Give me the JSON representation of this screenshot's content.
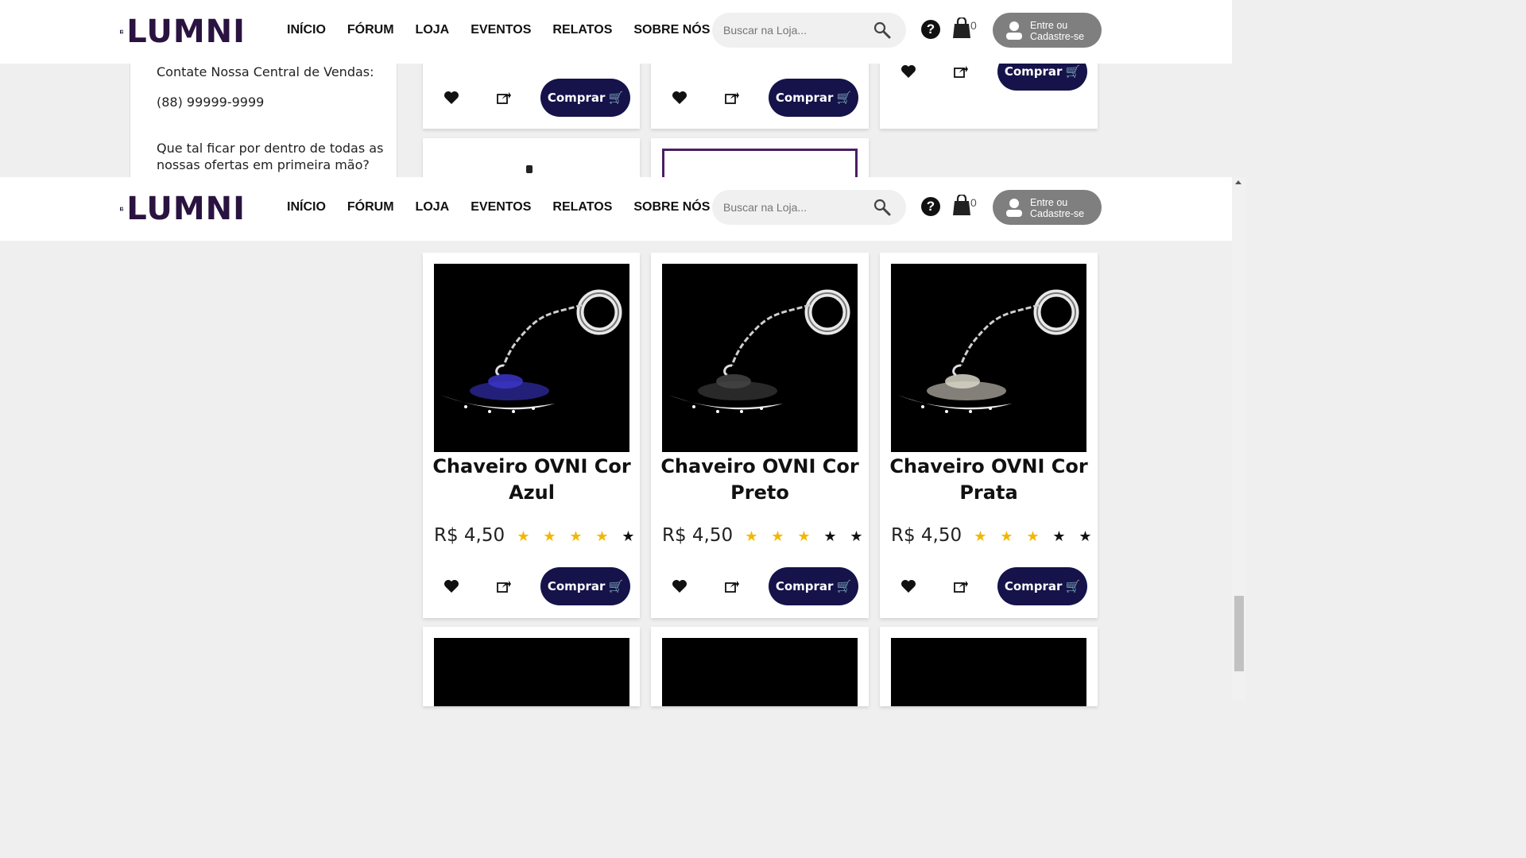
{
  "brand": {
    "name": "LUMNI"
  },
  "nav": {
    "items": [
      "INÍCIO",
      "FÓRUM",
      "LOJA",
      "EVENTOS",
      "RELATOS",
      "SOBRE NÓS"
    ]
  },
  "search": {
    "placeholder": "Buscar na Loja..."
  },
  "help_icon_glyph": "?",
  "cart": {
    "count": "0"
  },
  "login": {
    "line1": "Entre ou",
    "line2": "Cadastre-se"
  },
  "sidebar": {
    "contact_text": "Contate Nossa Central de Vendas:",
    "phone": "(88) 99999-9999",
    "newsletter_text": "Que tal ficar por dentro de todas as nossas ofertas em primeira mão?"
  },
  "buy_label": "Comprar",
  "products": [
    {
      "title_line1": "Chaveiro OVNI Cor",
      "title_line2": "Azul",
      "price": "R$ 4,50",
      "rating": 4,
      "accent": "#3b35c9"
    },
    {
      "title_line1": "Chaveiro OVNI Cor",
      "title_line2": "Preto",
      "price": "R$ 4,50",
      "rating": 3,
      "accent": "#444444"
    },
    {
      "title_line1": "Chaveiro OVNI Cor",
      "title_line2": "Prata",
      "price": "R$ 4,50",
      "rating": 3,
      "accent": "#d9d6c8"
    }
  ],
  "colors": {
    "buy_button": "#15134a",
    "star_on": "#f2b705",
    "login_bg": "#7f7f7f",
    "brand": "#2a1340"
  }
}
